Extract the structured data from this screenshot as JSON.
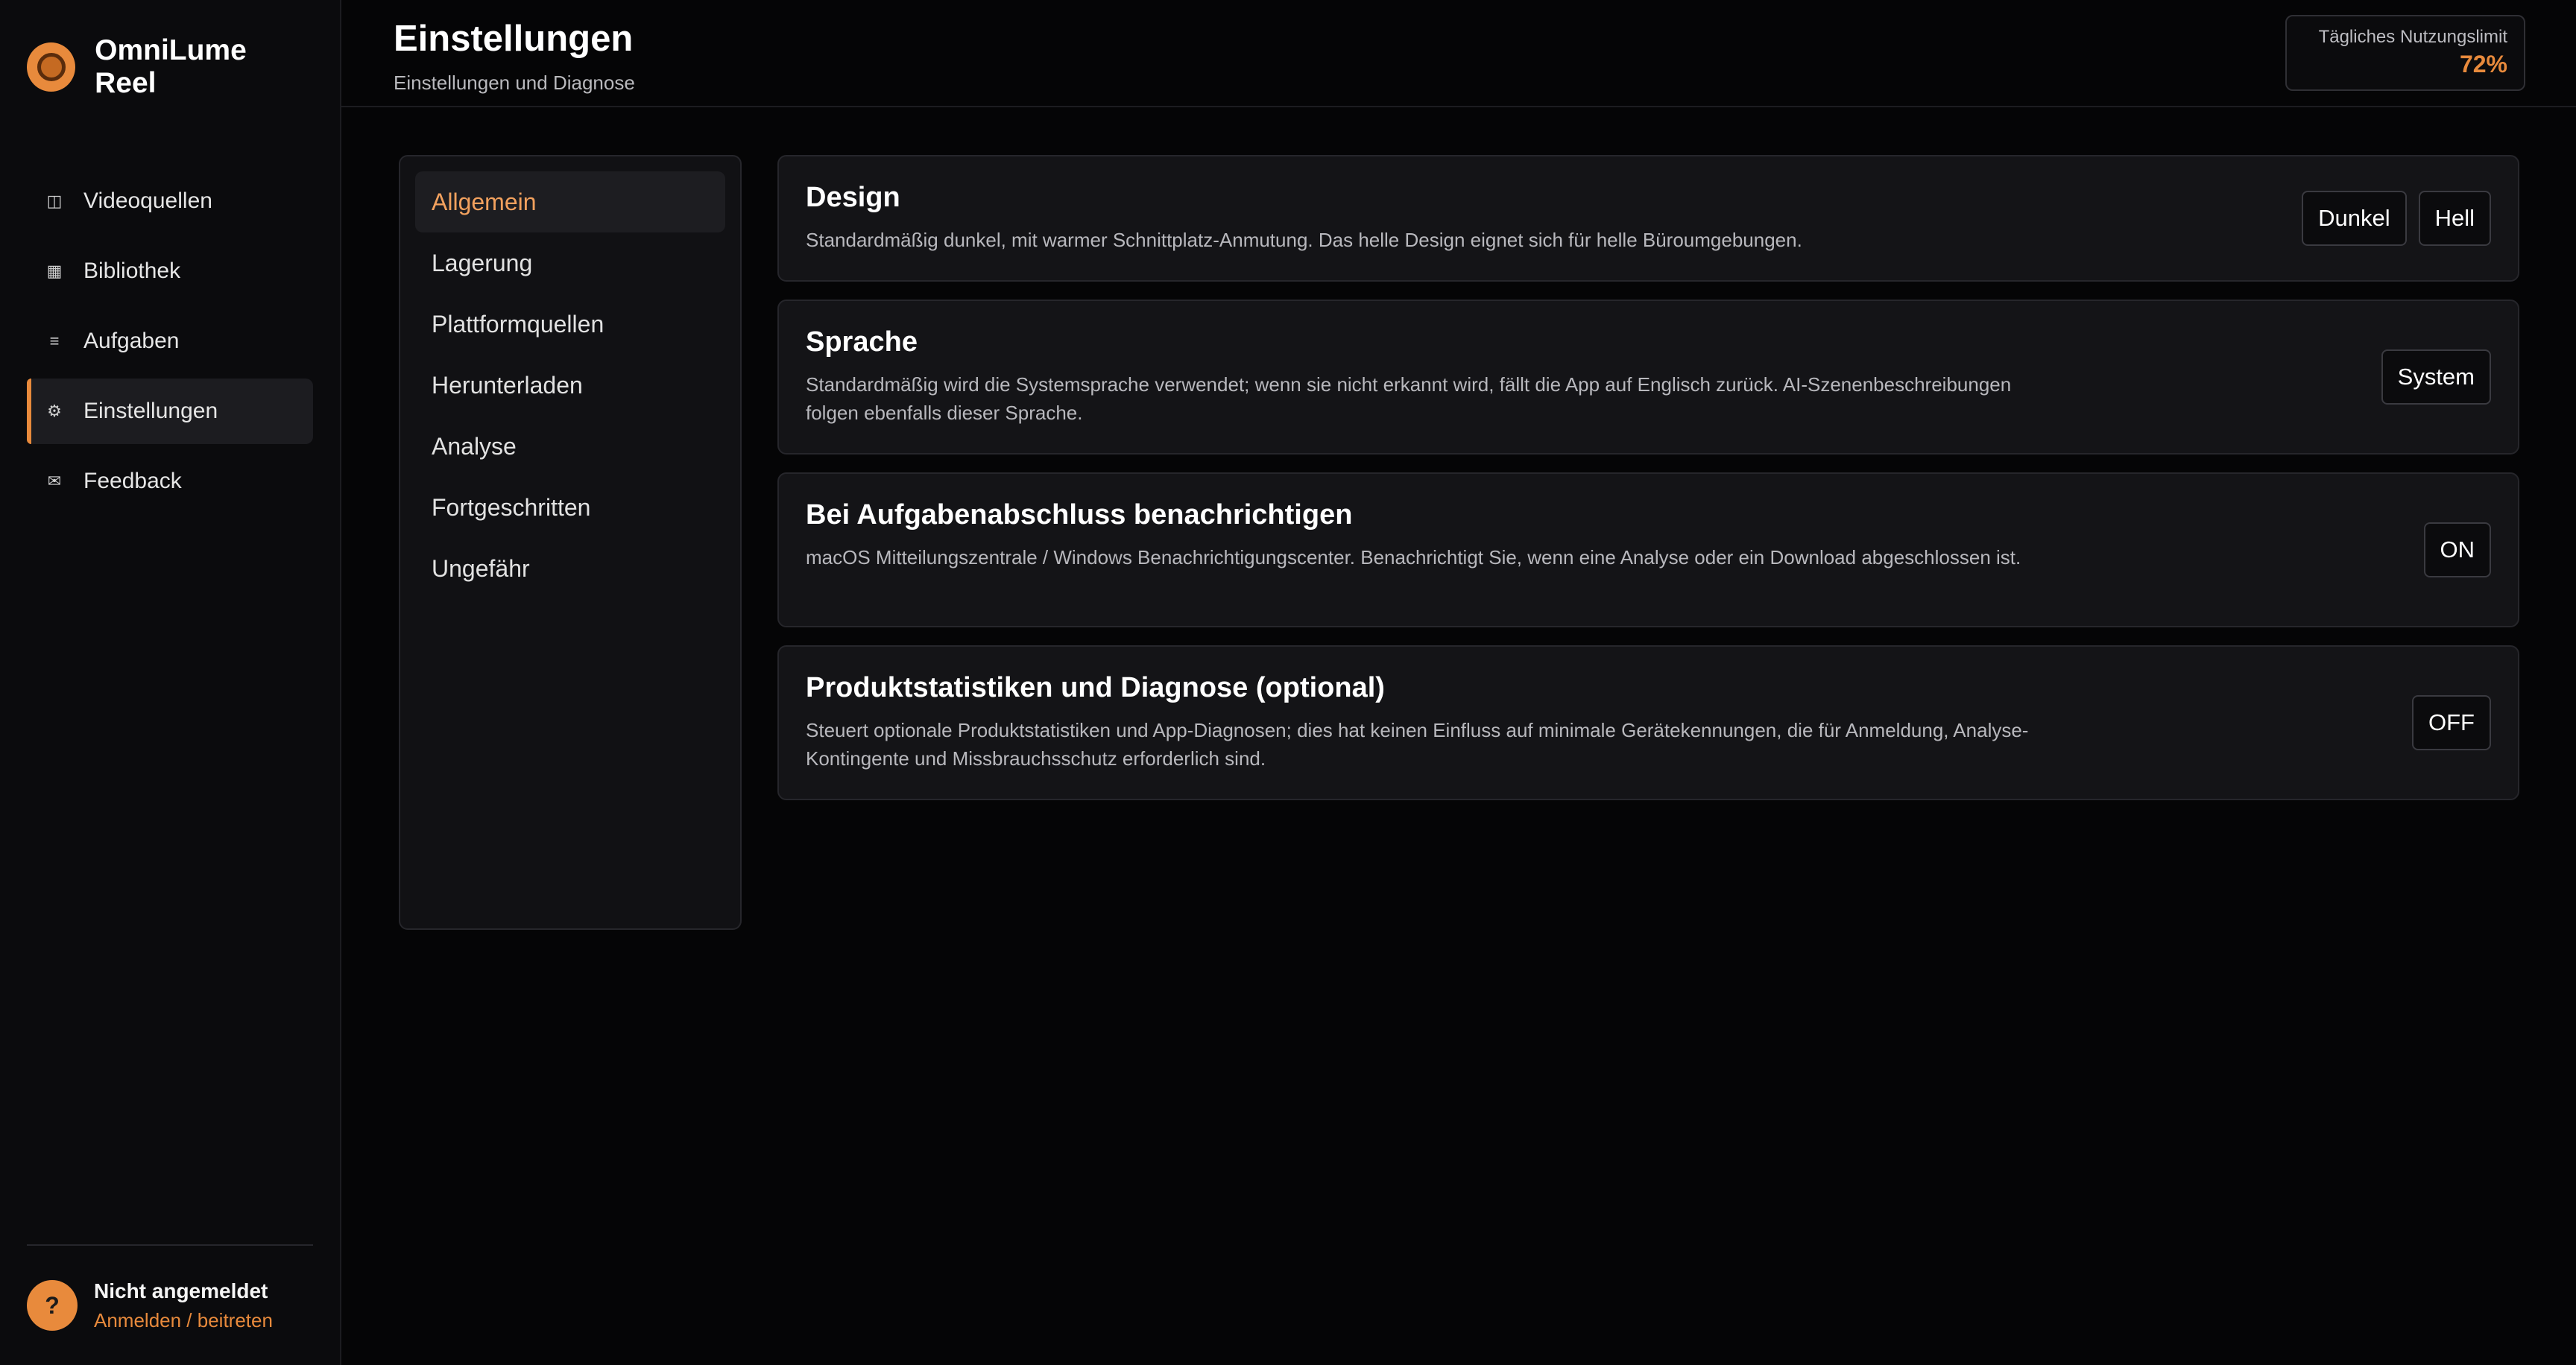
{
  "app": {
    "name": "OmniLume Reel"
  },
  "sidebar": {
    "items": [
      {
        "label": "Videoquellen",
        "icon": "◫"
      },
      {
        "label": "Bibliothek",
        "icon": "▦"
      },
      {
        "label": "Aufgaben",
        "icon": "≡"
      },
      {
        "label": "Einstellungen",
        "icon": "⚙",
        "active": true
      },
      {
        "label": "Feedback",
        "icon": "✉"
      }
    ],
    "user": {
      "avatar": "?",
      "status": "Nicht angemeldet",
      "link": "Anmelden / beitreten"
    }
  },
  "header": {
    "title": "Einstellungen",
    "subtitle": "Einstellungen und Diagnose",
    "usage": {
      "label": "Tägliches Nutzungslimit",
      "value": "72%"
    }
  },
  "subnav": {
    "items": [
      {
        "label": "Allgemein",
        "active": true
      },
      {
        "label": "Lagerung"
      },
      {
        "label": "Plattformquellen"
      },
      {
        "label": "Herunterladen"
      },
      {
        "label": "Analyse"
      },
      {
        "label": "Fortgeschritten"
      },
      {
        "label": "Ungefähr"
      }
    ]
  },
  "settings": [
    {
      "title": "Design",
      "desc": "Standardmäßig dunkel, mit warmer Schnittplatz-Anmutung. Das helle Design eignet sich für helle Büroumgebungen.",
      "buttons": [
        "Dunkel",
        "Hell"
      ]
    },
    {
      "title": "Sprache",
      "desc": "Standardmäßig wird die Systemsprache verwendet; wenn sie nicht erkannt wird, fällt die App auf Englisch zurück. AI-Szenenbeschreibungen folgen ebenfalls dieser Sprache.",
      "buttons": [
        "System"
      ]
    },
    {
      "title": "Bei Aufgabenabschluss benachrichtigen",
      "desc": "macOS Mitteilungszentrale / Windows Benachrichtigungscenter. Benachrichtigt Sie, wenn eine Analyse oder ein Download abgeschlossen ist.",
      "buttons": [
        "ON"
      ]
    },
    {
      "title": "Produktstatistiken und Diagnose (optional)",
      "desc": "Steuert optionale Produktstatistiken und App-Diagnosen; dies hat keinen Einfluss auf minimale Gerätekennungen, die für Anmeldung, Analyse-Kontingente und Missbrauchsschutz erforderlich sind.",
      "buttons": [
        "OFF"
      ]
    }
  ],
  "colors": {
    "accent": "#e88a3c",
    "background": "#050506",
    "card": "#141417"
  }
}
